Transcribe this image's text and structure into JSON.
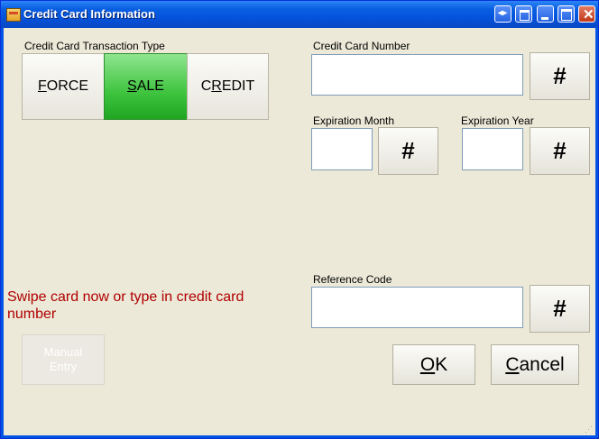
{
  "window": {
    "title": "Credit Card Information"
  },
  "transaction_type": {
    "label": "Credit Card Transaction Type",
    "options": [
      {
        "label": "FORCE",
        "mnemonic": "F",
        "rest": "ORCE",
        "pre": ""
      },
      {
        "label": "SALE",
        "mnemonic": "S",
        "rest": "ALE",
        "pre": "",
        "selected": true
      },
      {
        "label": "CREDIT",
        "mnemonic": "R",
        "rest": "EDIT",
        "pre": "C"
      }
    ]
  },
  "card_number": {
    "label": "Credit Card Number",
    "value": "",
    "keypad_label": "#"
  },
  "exp_month": {
    "label": "Expiration Month",
    "value": "",
    "keypad_label": "#"
  },
  "exp_year": {
    "label": "Expiration Year",
    "value": "",
    "keypad_label": "#"
  },
  "reference": {
    "label": "Reference Code",
    "value": "",
    "keypad_label": "#"
  },
  "swipe_message": "Swipe card now or type in credit card number",
  "manual_entry": {
    "line1": "Manual",
    "line2": "Entry"
  },
  "ok": {
    "mnemonic": "O",
    "rest": "K"
  },
  "cancel": {
    "mnemonic": "C",
    "rest": "ancel"
  },
  "colors": {
    "selected": "#3ec43e",
    "message": "#b00000",
    "titlebar": "#0454dd"
  }
}
